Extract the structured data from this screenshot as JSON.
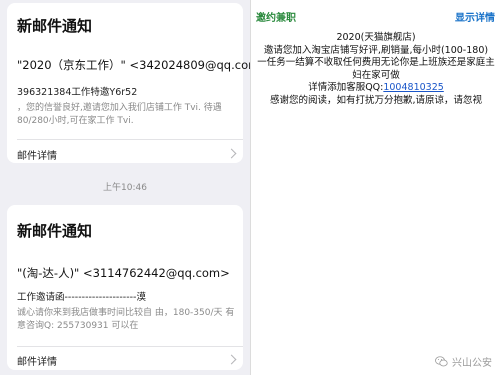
{
  "left": {
    "cards": [
      {
        "title": "新邮件通知",
        "from": "\"2020（京东工作）\" <342024809@qq.com>",
        "subject": "396321384工作特邀Y6r52",
        "body": "，您的信誉良好,邀请您加入我们店铺工作 Tvi. 待遇80/280小时,可在家工作 Tvi.",
        "detail_label": "邮件详情"
      },
      {
        "title": "新邮件通知",
        "from": "\"(淘-达-人)\" <3114762442@qq.com>",
        "subject": "工作邀请函---------------------漠",
        "body": "诚心请你来到我店做事时间比较自 由，180-350/天 有意咨询Q: 255730931 可以在",
        "detail_label": "邮件详情"
      }
    ],
    "time": "上午10:46"
  },
  "right": {
    "left_label": "邀约兼职",
    "right_label": "显示详情",
    "lines": [
      "2020(天猫旗舰店)",
      "邀请您加入淘宝店铺写好评,刷销量,每小时(100-180)",
      "一任务一结算不收取任何费用无论你是上班族还是家庭主",
      "妇在家可做"
    ],
    "contact_prefix": "详情添加客服QQ:",
    "contact_qq": "1004810325",
    "closing": "感谢您的阅读，如有打扰万分抱歉,请原谅，请忽视"
  },
  "watermark": {
    "text": "兴山公安"
  },
  "colors": {
    "left_bg": "#efeff4",
    "green_label": "#2b8a3e",
    "blue_label": "#1a73c9",
    "link": "#1a56c9"
  }
}
